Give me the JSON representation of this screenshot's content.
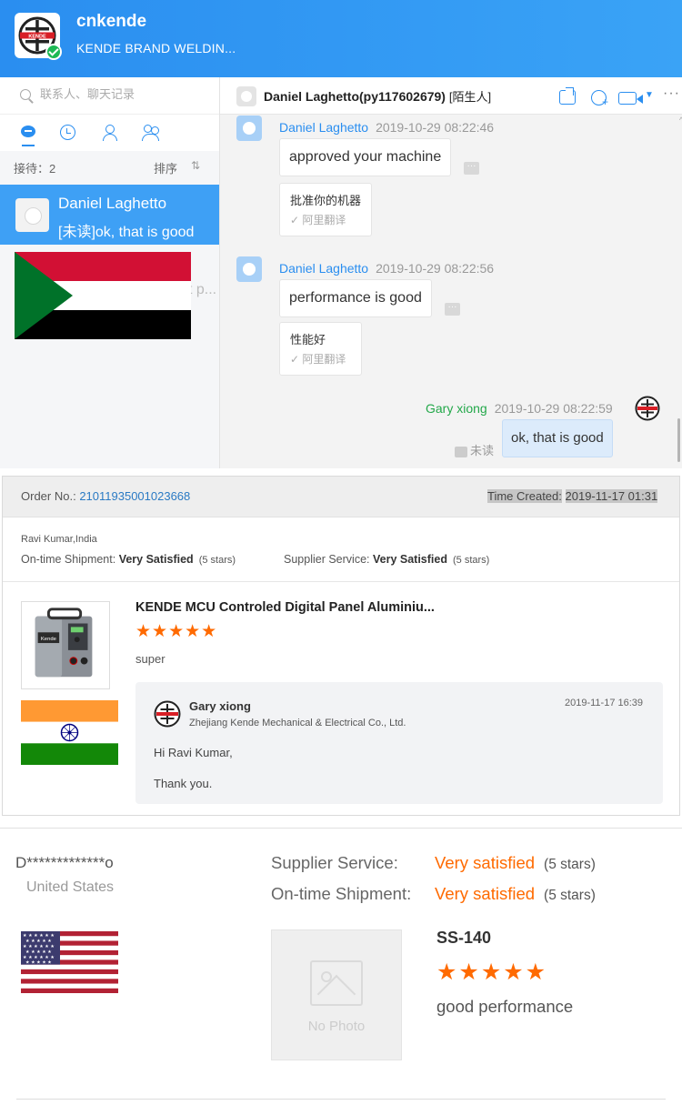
{
  "app": {
    "name": "cnkende",
    "subtitle": "KENDE BRAND WELDIN..."
  },
  "sidebar": {
    "search_placeholder": "联系人、聊天记录",
    "reception_label": "接待：2",
    "sort_label": "排序",
    "sort_icon": "⇅",
    "conversation": {
      "name": "Daniel Laghetto",
      "preview": "[未读]ok, that is good"
    },
    "hidden_fragment": "t p..."
  },
  "chat": {
    "header_title": "Daniel Laghetto(py117602679)",
    "header_tag": "[陌生人]",
    "messages": [
      {
        "sender": "Daniel Laghetto",
        "time": "2019-10-29 08:22:46",
        "text": "approved your machine",
        "translation": "批准你的机器",
        "translation_source": "✓ 阿里翻译"
      },
      {
        "sender": "Daniel Laghetto",
        "time": "2019-10-29 08:22:56",
        "text": "performance is good",
        "translation": "性能好",
        "translation_source": "✓ 阿里翻译"
      }
    ],
    "self_message": {
      "sender": "Gary xiong",
      "time": "2019-10-29 08:22:59",
      "text": "ok, that is good",
      "status": "未读"
    },
    "more_dots": "···",
    "overflow_mark": "^"
  },
  "order_review": {
    "order_label": "Order No.:",
    "order_number": "21011935001023668",
    "time_created_label": "Time Created:",
    "time_created": "2019-11-17 01:31",
    "reviewer": "Ravi Kumar,India",
    "shipment_label": "On-time Shipment:",
    "shipment_value": "Very Satisfied",
    "shipment_stars": "(5 stars)",
    "supplier_label": "Supplier Service:",
    "supplier_value": "Very Satisfied",
    "supplier_stars": "(5 stars)",
    "product_title": "KENDE MCU Controled Digital Panel Aluminiu...",
    "rating": 5,
    "star_glyphs": "★★★★★",
    "review_text": "super",
    "reply": {
      "name": "Gary xiong",
      "company": "Zhejiang Kende Mechanical & Electrical Co., Ltd.",
      "time": "2019-11-17 16:39",
      "greeting": "Hi Ravi Kumar,",
      "closing": "Thank you."
    }
  },
  "us_review": {
    "buyer": "D*************o",
    "country": "United States",
    "supplier_label": "Supplier Service:",
    "supplier_value": "Very satisfied",
    "supplier_stars": "(5 stars)",
    "shipment_label": "On-time Shipment:",
    "shipment_value": "Very satisfied",
    "shipment_stars": "(5 stars)",
    "no_photo": "No Photo",
    "model": "SS-140",
    "rating": 5,
    "star_glyphs": "★★★★★",
    "review_text": "good performance"
  },
  "icons": {
    "product": "welding-machine-icon",
    "brand": "kende-logo"
  },
  "colors": {
    "app_blue": "#2a8ef0",
    "selected_row": "#3ea0f5",
    "self_name_green": "#23a84a",
    "star_orange": "#ff6a00",
    "link_blue": "#2a7ac4"
  }
}
